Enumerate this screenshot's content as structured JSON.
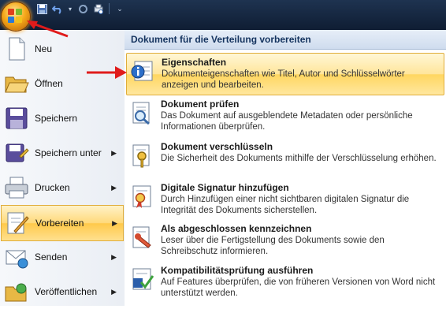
{
  "quick_access": {
    "save_icon": "save-icon",
    "undo_icon": "undo-icon",
    "redo_icon": "redo-icon",
    "print_icon": "print-preview-icon",
    "customize_icon": "customize-qat-icon"
  },
  "left_menu": [
    {
      "label": "Neu",
      "icon": "new-document-icon",
      "submenu": false
    },
    {
      "label": "Öffnen",
      "icon": "open-folder-icon",
      "submenu": false
    },
    {
      "label": "Speichern",
      "icon": "save-disk-icon",
      "submenu": false
    },
    {
      "label": "Speichern unter",
      "icon": "save-as-icon",
      "submenu": true
    },
    {
      "label": "Drucken",
      "icon": "printer-icon",
      "submenu": true
    },
    {
      "label": "Vorbereiten",
      "icon": "prepare-icon",
      "submenu": true,
      "active": true
    },
    {
      "label": "Senden",
      "icon": "send-icon",
      "submenu": true
    },
    {
      "label": "Veröffentlichen",
      "icon": "publish-icon",
      "submenu": true
    }
  ],
  "right_panel": {
    "header": "Dokument für die Verteilung vorbereiten",
    "items": [
      {
        "title": "Eigenschaften",
        "description": "Dokumenteigenschaften wie Titel, Autor und Schlüsselwörter anzeigen und bearbeiten.",
        "icon": "properties-icon",
        "active": true
      },
      {
        "title": "Dokument prüfen",
        "description": "Das Dokument auf ausgeblendete Metadaten oder persönliche Informationen überprüfen.",
        "icon": "inspect-document-icon"
      },
      {
        "title": "Dokument verschlüsseln",
        "description": "Die Sicherheit des Dokuments mithilfe der Verschlüsselung erhöhen.",
        "icon": "encrypt-key-icon"
      },
      {
        "title": "Digitale Signatur hinzufügen",
        "description": "Durch Hinzufügen einer nicht sichtbaren digitalen Signatur die Integrität des Dokuments sicherstellen.",
        "icon": "digital-signature-icon"
      },
      {
        "title": "Als abgeschlossen kennzeichnen",
        "description": "Leser über die Fertigstellung des Dokuments sowie den Schreibschutz informieren.",
        "icon": "mark-as-final-icon"
      },
      {
        "title": "Kompatibilitätsprüfung ausführen",
        "description": "Auf Features überprüfen, die von früheren Versionen von Word nicht unterstützt werden.",
        "icon": "compatibility-checker-icon"
      }
    ]
  },
  "colors": {
    "highlight": "#ffd97a",
    "titlebar": "#1e3350",
    "annotation_arrow": "#e01b1b"
  }
}
